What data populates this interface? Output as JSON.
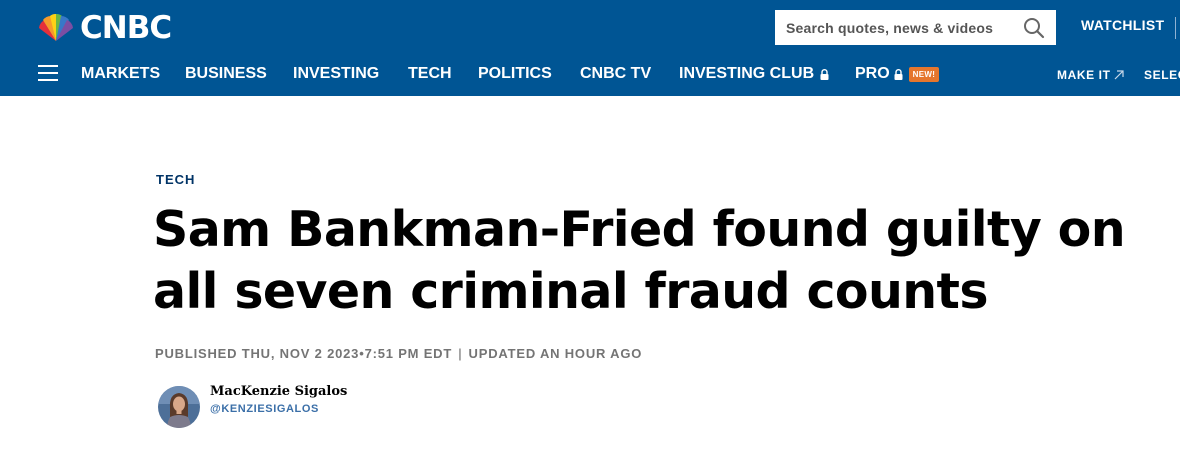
{
  "header": {
    "logo_text": "CNBC",
    "search": {
      "placeholder": "Search quotes, news & videos"
    },
    "watchlist_label": "WATCHLIST",
    "nav": [
      {
        "label": "MARKETS"
      },
      {
        "label": "BUSINESS"
      },
      {
        "label": "INVESTING"
      },
      {
        "label": "TECH"
      },
      {
        "label": "POLITICS"
      },
      {
        "label": "CNBC TV"
      },
      {
        "label": "INVESTING CLUB",
        "locked": true
      },
      {
        "label": "PRO",
        "locked": true,
        "badge": "NEW!"
      }
    ],
    "nav_right": [
      {
        "label": "MAKE IT",
        "icon": "external-arrow-icon"
      },
      {
        "label": "SELEC"
      }
    ]
  },
  "article": {
    "section": "TECH",
    "headline": "Sam Bankman-Fried found guilty on all seven criminal fraud counts",
    "published": "PUBLISHED THU, NOV 2 2023•7:51 PM EDT",
    "separator": "|",
    "updated": "UPDATED AN HOUR AGO",
    "author": {
      "name": "MacKenzie Sigalos",
      "handle": "@KENZIESIGALOS"
    }
  },
  "colors": {
    "header_bg": "#005594",
    "new_badge": "#e5762d",
    "section_label": "#003366",
    "author_handle": "#3b6fa8",
    "meta_text": "#747474"
  }
}
